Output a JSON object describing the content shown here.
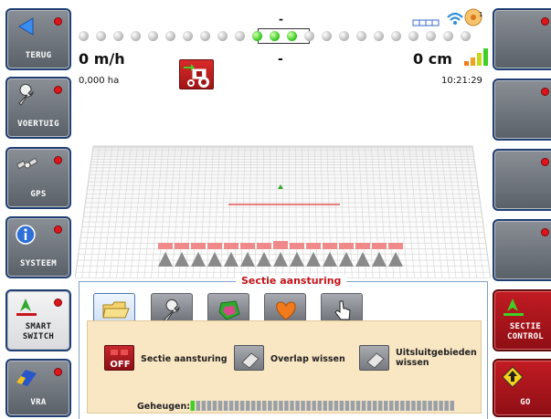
{
  "left_buttons": [
    {
      "label": "TERUG",
      "icon": "back-arrow-icon"
    },
    {
      "label": "VOERTUIG",
      "icon": "wrench-icon"
    },
    {
      "label": "GPS",
      "icon": "satellite-icon"
    },
    {
      "label": "SYSTEEM",
      "icon": "info-icon"
    },
    {
      "label": "SMART\nSWITCH",
      "icon": "smart-switch-icon"
    },
    {
      "label": "VRA",
      "icon": "vra-icon"
    }
  ],
  "right_buttons": [
    {
      "label": ""
    },
    {
      "label": ""
    },
    {
      "label": ""
    },
    {
      "label": ""
    },
    {
      "label": "SECTIE\nCONTROL",
      "icon": "section-control-icon"
    },
    {
      "label": "GO",
      "icon": "go-arrow-icon"
    }
  ],
  "status": {
    "speed": "0 m/h",
    "area": "0,000 ha",
    "center_top": "-",
    "center_mid": "-",
    "offset": "0 cm",
    "time": "10:21:29",
    "satellites": "1"
  },
  "lightbar": {
    "total": 23,
    "active": [
      10,
      11,
      12
    ]
  },
  "panel": {
    "title": "Sectie aansturing",
    "tabs": [
      "folder-icon",
      "wrench-icon",
      "boundary-icon",
      "heart-icon",
      "hand-pointer-icon"
    ],
    "items": [
      {
        "label": "Sectie aansturing",
        "badge": "OFF"
      },
      {
        "label": "Overlap wissen"
      },
      {
        "label": "Uitsluitgebieden\nwissen"
      }
    ],
    "memory_label": "Geheugen:",
    "memory_fill": 0.02
  },
  "colors": {
    "accent_red": "#c2141a",
    "active_green": "#3fcf25",
    "panel_bg": "#f9e6c3",
    "section_pink": "#f08a8a"
  }
}
